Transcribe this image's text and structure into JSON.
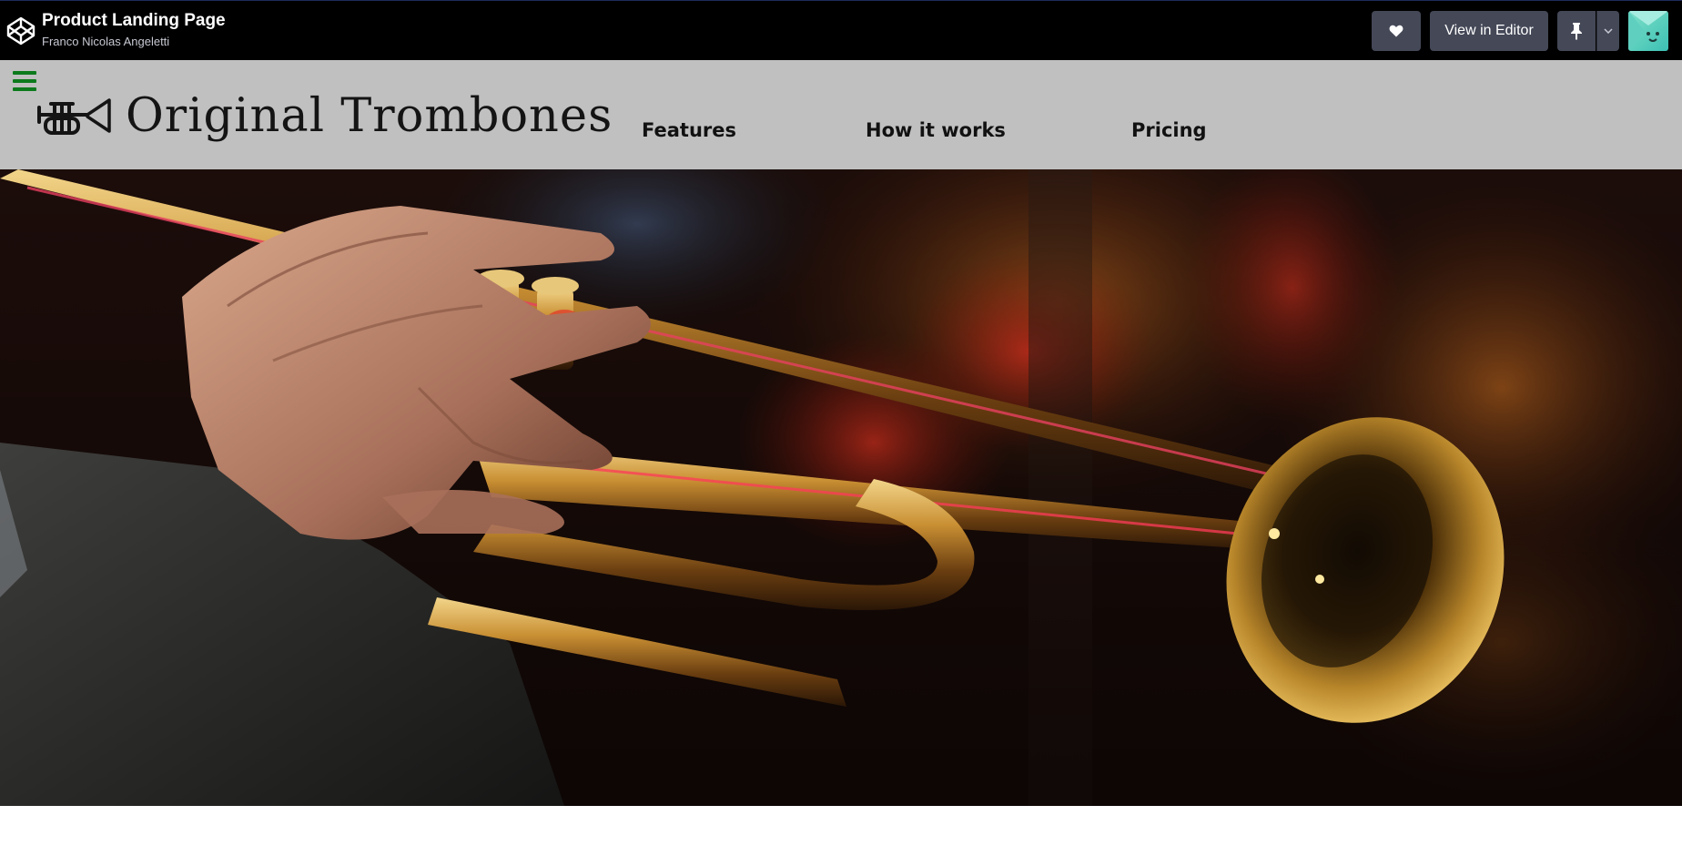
{
  "codepen": {
    "pen_title": "Product Landing Page",
    "author": "Franco Nicolas Angeletti",
    "view_in_editor_label": "View in Editor",
    "icons": {
      "logo": "codepen-logo-icon",
      "like": "heart-icon",
      "pin": "pin-icon",
      "pin_menu": "chevron-down-icon"
    },
    "colors": {
      "bar": "#000000",
      "button": "#444857"
    }
  },
  "site": {
    "brand_name": "Original Trombones",
    "brand_icon": "trumpet-logo-icon",
    "menu_icon": "hamburger-menu-icon",
    "nav": [
      {
        "label": "Features"
      },
      {
        "label": "How it works"
      },
      {
        "label": "Pricing"
      }
    ],
    "colors": {
      "header_bg": "#c0c0c0",
      "menu_icon": "#0c7a1c"
    }
  },
  "hero": {
    "image": "photo of a hand playing a brass trumpet"
  }
}
